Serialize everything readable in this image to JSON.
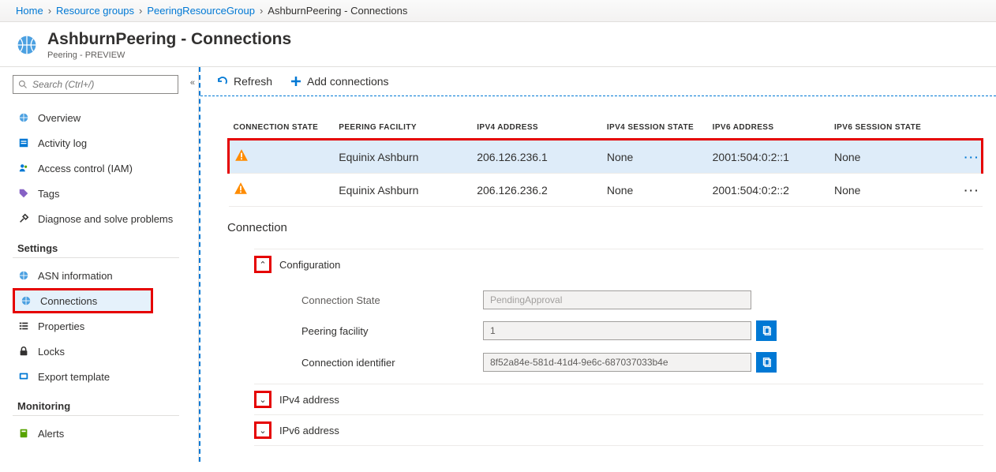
{
  "breadcrumb": {
    "home": "Home",
    "rg": "Resource groups",
    "group": "PeeringResourceGroup",
    "current": "AshburnPeering - Connections"
  },
  "header": {
    "title": "AshburnPeering - Connections",
    "subtitle": "Peering - PREVIEW"
  },
  "search": {
    "placeholder": "Search (Ctrl+/)"
  },
  "nav": {
    "overview": "Overview",
    "activity": "Activity log",
    "iam": "Access control (IAM)",
    "tags": "Tags",
    "diag": "Diagnose and solve problems",
    "settings_header": "Settings",
    "asn": "ASN information",
    "connections": "Connections",
    "properties": "Properties",
    "locks": "Locks",
    "export": "Export template",
    "monitoring_header": "Monitoring",
    "alerts": "Alerts"
  },
  "toolbar": {
    "refresh": "Refresh",
    "add": "Add connections"
  },
  "table": {
    "headers": {
      "state": "CONNECTION STATE",
      "facility": "PEERING FACILITY",
      "ipv4": "IPV4 ADDRESS",
      "ipv4s": "IPV4 SESSION STATE",
      "ipv6": "IPV6 ADDRESS",
      "ipv6s": "IPV6 SESSION STATE"
    },
    "rows": [
      {
        "facility": "Equinix Ashburn",
        "ipv4": "206.126.236.1",
        "ipv4s": "None",
        "ipv6": "2001:504:0:2::1",
        "ipv6s": "None"
      },
      {
        "facility": "Equinix Ashburn",
        "ipv4": "206.126.236.2",
        "ipv4s": "None",
        "ipv6": "2001:504:0:2::2",
        "ipv6s": "None"
      }
    ]
  },
  "detail": {
    "heading": "Connection",
    "config_label": "Configuration",
    "ipv4_label": "IPv4 address",
    "ipv6_label": "IPv6 address",
    "fields": {
      "conn_state_label": "Connection State",
      "conn_state_value": "PendingApproval",
      "facility_label": "Peering facility",
      "facility_value": "1",
      "conn_id_label": "Connection identifier",
      "conn_id_value": "8f52a84e-581d-41d4-9e6c-687037033b4e"
    }
  }
}
